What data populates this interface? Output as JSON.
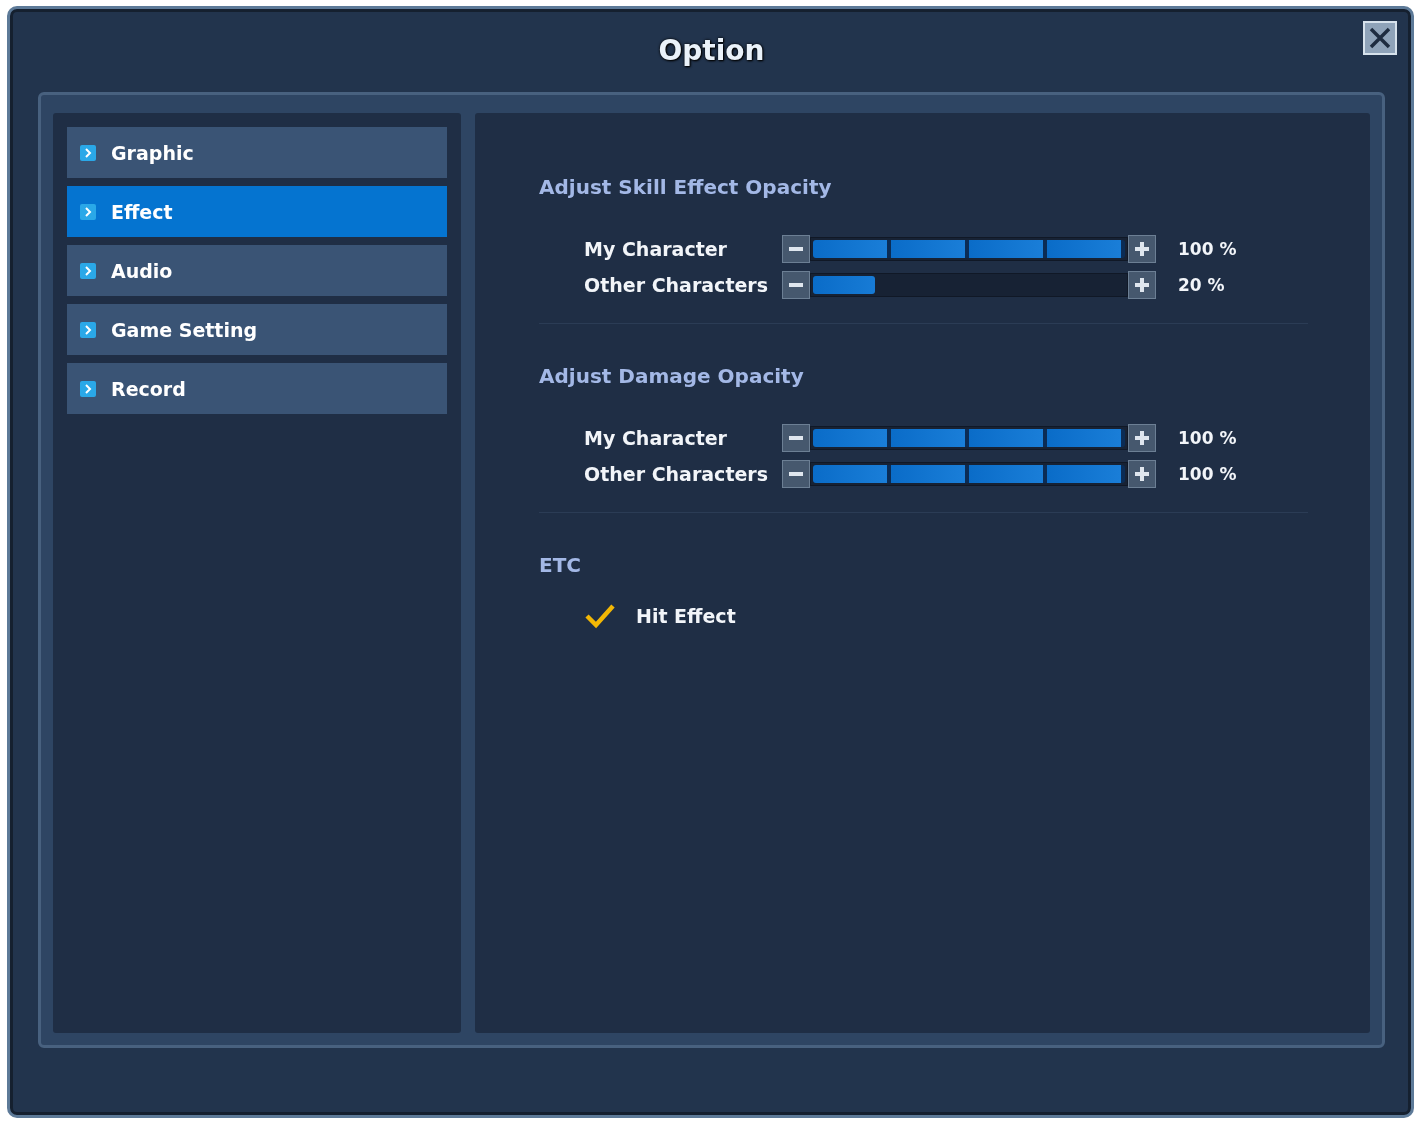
{
  "window": {
    "title": "Option"
  },
  "sidebar": {
    "items": [
      {
        "label": "Graphic",
        "selected": false
      },
      {
        "label": "Effect",
        "selected": true
      },
      {
        "label": "Audio",
        "selected": false
      },
      {
        "label": "Game Setting",
        "selected": false
      },
      {
        "label": "Record",
        "selected": false
      }
    ]
  },
  "sections": [
    {
      "title": "Adjust Skill Effect Opacity",
      "kind": "sliders",
      "rows": [
        {
          "label": "My Character",
          "level": 1,
          "reading": "100 %"
        },
        {
          "label": "Other Characters",
          "level": 0.2,
          "reading": "20 %"
        }
      ]
    },
    {
      "title": "Adjust Damage Opacity",
      "kind": "sliders",
      "rows": [
        {
          "label": "My Character",
          "level": 1,
          "reading": "100 %"
        },
        {
          "label": "Other Characters",
          "level": 1,
          "reading": "100 %"
        }
      ]
    },
    {
      "title": "ETC",
      "kind": "checks",
      "rows": [
        {
          "label": "Hit Effect",
          "checked": true
        }
      ]
    }
  ]
}
